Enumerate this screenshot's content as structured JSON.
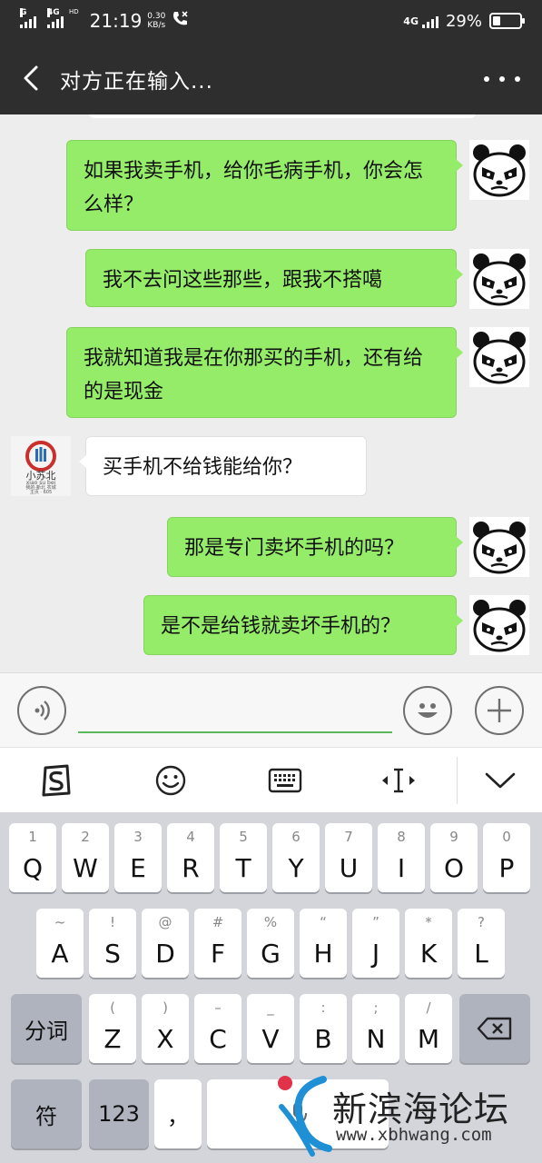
{
  "status_bar": {
    "sim1": "G",
    "sim2": "4G",
    "sim2_sup": "HD",
    "time": "21:19",
    "speed_value": "0.30",
    "speed_unit": "KB/s",
    "network": "4G",
    "battery_pct": "29%",
    "battery_level": 0.29
  },
  "header": {
    "title": "对方正在输入..."
  },
  "messages": [
    {
      "side": "out",
      "text": "如果我卖手机，给你毛病手机，你会怎么样？"
    },
    {
      "side": "out",
      "text": "我不去问这些那些，跟我不搭噶"
    },
    {
      "side": "out",
      "text": "我就知道我是在你那买的手机，还有给的是现金"
    },
    {
      "side": "in",
      "text": "买手机不给钱能给你？"
    },
    {
      "side": "out",
      "text": "那是专门卖坏手机的吗？"
    },
    {
      "side": "out",
      "text": "是不是给钱就卖坏手机的？"
    }
  ],
  "contact_avatar": {
    "logo_text": "小苏北",
    "logo_pinyin": "xiao su bei",
    "logo_small": "我的·新北 农城",
    "logo_small2": "主页 · 605"
  },
  "input": {
    "value": "",
    "placeholder": ""
  },
  "keyboard": {
    "row1": [
      {
        "num": "1",
        "key": "Q"
      },
      {
        "num": "2",
        "key": "W"
      },
      {
        "num": "3",
        "key": "E"
      },
      {
        "num": "4",
        "key": "R"
      },
      {
        "num": "5",
        "key": "T"
      },
      {
        "num": "6",
        "key": "Y"
      },
      {
        "num": "7",
        "key": "U"
      },
      {
        "num": "8",
        "key": "I"
      },
      {
        "num": "9",
        "key": "O"
      },
      {
        "num": "0",
        "key": "P"
      }
    ],
    "row2": [
      {
        "num": "~",
        "key": "A"
      },
      {
        "num": "!",
        "key": "S"
      },
      {
        "num": "@",
        "key": "D"
      },
      {
        "num": "#",
        "key": "F"
      },
      {
        "num": "%",
        "key": "G"
      },
      {
        "num": "“",
        "key": "H"
      },
      {
        "num": "”",
        "key": "J"
      },
      {
        "num": "*",
        "key": "K"
      },
      {
        "num": "?",
        "key": "L"
      }
    ],
    "row3": [
      {
        "num": "(",
        "key": "Z"
      },
      {
        "num": ")",
        "key": "X"
      },
      {
        "num": "–",
        "key": "C"
      },
      {
        "num": "_",
        "key": "V"
      },
      {
        "num": ":",
        "key": "B"
      },
      {
        "num": ";",
        "key": "N"
      },
      {
        "num": "/",
        "key": "M"
      }
    ],
    "fenci_label": "分词",
    "fu_label": "符",
    "num_label": "123",
    "comma_label": "，"
  },
  "watermark": {
    "title": "新滨海论坛",
    "url": "www.xbhwang.com"
  },
  "colors": {
    "header_bg": "#2e2e2e",
    "chat_bg": "#ededed",
    "bubble_out": "#95ec69",
    "bubble_in": "#ffffff",
    "input_underline": "#5cb85c"
  }
}
